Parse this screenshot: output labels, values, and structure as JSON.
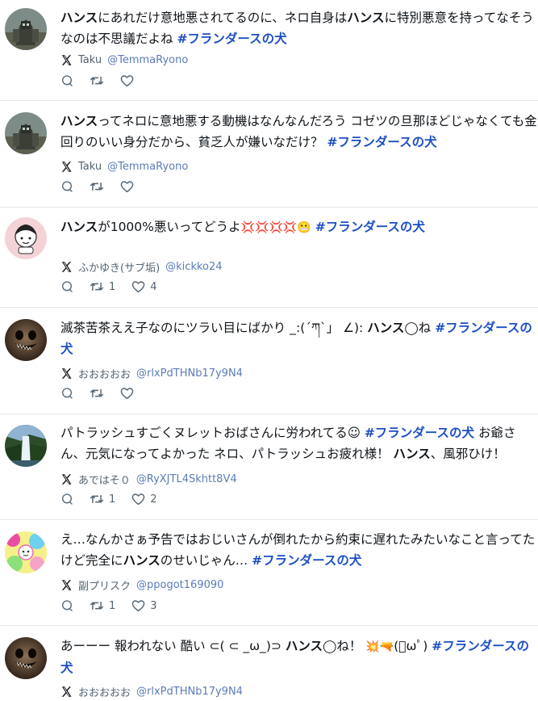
{
  "posts": [
    {
      "segments": [
        {
          "t": "kw",
          "v": "ハンス"
        },
        {
          "t": "txt",
          "v": "にあれだけ意地悪されてるのに、ネロ自身は"
        },
        {
          "t": "kw",
          "v": "ハンス"
        },
        {
          "t": "txt",
          "v": "に特別悪意を持ってなそうなのは不思議だよね "
        },
        {
          "t": "tag",
          "v": "#フランダースの犬"
        }
      ],
      "name": "Taku",
      "handle": "@TemmaRyono",
      "replies": "",
      "retweets": "",
      "likes": "",
      "avatar": "robot"
    },
    {
      "segments": [
        {
          "t": "kw",
          "v": "ハンス"
        },
        {
          "t": "txt",
          "v": "ってネロに意地悪する動機はなんなんだろう コゼツの旦那ほどじゃなくても金回りのいい身分だから、貧乏人が嫌いなだけ？ "
        },
        {
          "t": "tag",
          "v": "#フランダースの犬"
        }
      ],
      "name": "Taku",
      "handle": "@TemmaRyono",
      "replies": "",
      "retweets": "",
      "likes": "",
      "avatar": "robot"
    },
    {
      "segments": [
        {
          "t": "kw",
          "v": "ハンス"
        },
        {
          "t": "txt",
          "v": "が1000%悪いってどうよ"
        },
        {
          "t": "emoji",
          "v": "💢💢💢💢😬"
        },
        {
          "t": "txt",
          "v": " "
        },
        {
          "t": "tag",
          "v": "#フランダースの犬"
        }
      ],
      "name": "ふかゆき(サブ垢)",
      "handle": "@kickko24",
      "replies": "",
      "retweets": "1",
      "likes": "4",
      "avatar": "girl"
    },
    {
      "segments": [
        {
          "t": "txt",
          "v": "滅茶苦茶ええ子なのにツラい目にばかり _:(´ཀ`」 ∠): "
        },
        {
          "t": "kw",
          "v": "ハンス"
        },
        {
          "t": "txt",
          "v": "◯ね "
        },
        {
          "t": "tag",
          "v": "#フランダースの犬"
        }
      ],
      "name": "おおおおお",
      "handle": "@rlxPdTHNb17y9N4",
      "replies": "",
      "retweets": "",
      "likes": "",
      "avatar": "face"
    },
    {
      "segments": [
        {
          "t": "txt",
          "v": "パトラッシュすごくヌレットおばさんに労われてる☺ "
        },
        {
          "t": "tag",
          "v": "#フランダースの犬"
        },
        {
          "t": "txt",
          "v": " お爺さん、元気になってよかった ネロ、パトラッシュお疲れ様！ "
        },
        {
          "t": "kw",
          "v": "ハンス"
        },
        {
          "t": "txt",
          "v": "、風邪ひけ！"
        }
      ],
      "name": "あではそ０",
      "handle": "@RyXJTL4Skhtt8V4",
      "replies": "",
      "retweets": "1",
      "likes": "2",
      "avatar": "waterfall"
    },
    {
      "segments": [
        {
          "t": "txt",
          "v": "え…なんかさぁ予告ではおじいさんが倒れたから約束に遅れたみたいなこと言ってたけど完全に"
        },
        {
          "t": "kw",
          "v": "ハンス"
        },
        {
          "t": "txt",
          "v": "のせいじゃん… "
        },
        {
          "t": "tag",
          "v": "#フランダースの犬"
        }
      ],
      "name": "副プリスク",
      "handle": "@ppogot169090",
      "replies": "",
      "retweets": "1",
      "likes": "3",
      "avatar": "colorful"
    },
    {
      "segments": [
        {
          "t": "txt",
          "v": "あーーー 報われない 酷い ⊂( ⊂ _ω_)⊃ "
        },
        {
          "t": "kw",
          "v": "ハンス"
        },
        {
          "t": "txt",
          "v": "◯ね！ "
        },
        {
          "t": "emoji",
          "v": "💥🔫"
        },
        {
          "t": "txt",
          "v": "(ﾟωﾟ) "
        },
        {
          "t": "tag",
          "v": "#フランダースの犬"
        }
      ],
      "name": "おおおおお",
      "handle": "@rlxPdTHNb17y9N4",
      "replies": "",
      "retweets": "",
      "likes": "",
      "avatar": "face"
    }
  ],
  "icons": {
    "platform": "x-logo-icon",
    "reply": "reply-icon",
    "retweet": "retweet-icon",
    "like": "heart-icon"
  },
  "colors": {
    "hashtag": "#1d4fc4",
    "handle": "#5b7bb7",
    "muted": "#536471",
    "divider": "#e5e7ea"
  }
}
